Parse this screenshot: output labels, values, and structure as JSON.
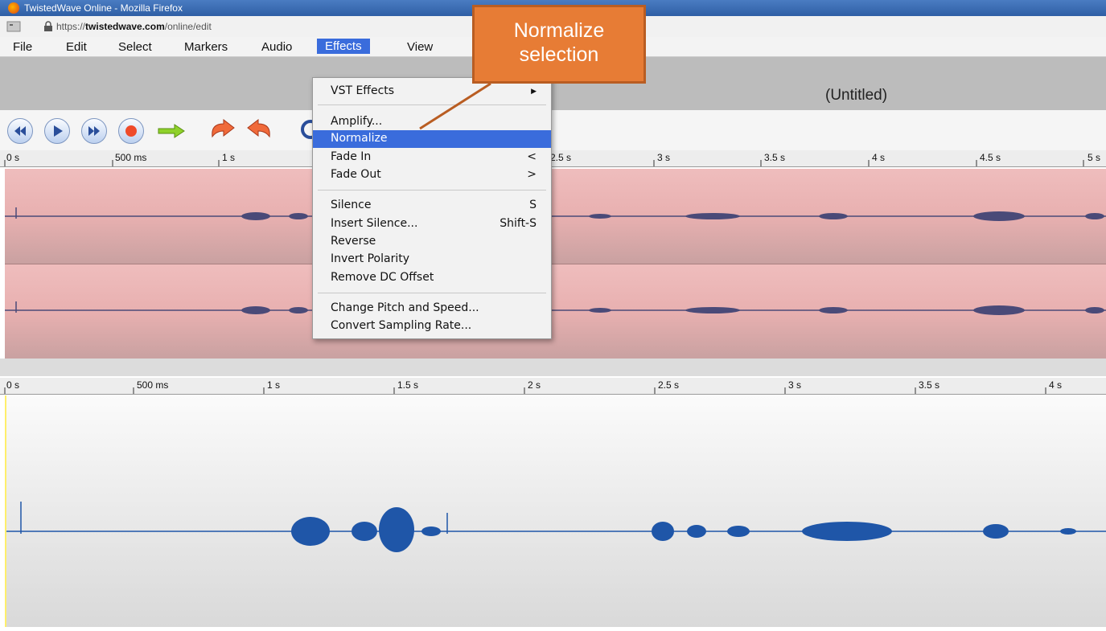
{
  "window": {
    "title": "TwistedWave Online - Mozilla Firefox",
    "url_prefix": "https://",
    "url_domain": "twistedwave.com",
    "url_path": "/online/edit"
  },
  "menubar": {
    "items": [
      "File",
      "Edit",
      "Select",
      "Markers",
      "Audio",
      "Effects",
      "View"
    ],
    "active": "Effects"
  },
  "document": {
    "title": "(Untitled)"
  },
  "rulers": {
    "top": [
      "0 s",
      "500 ms",
      "1 s",
      "2.5 s",
      "3 s",
      "3.5 s",
      "4 s",
      "4.5 s",
      "5 s"
    ],
    "bottom": [
      "0 s",
      "500 ms",
      "1 s",
      "1.5 s",
      "2 s",
      "2.5 s",
      "3 s",
      "3.5 s",
      "4 s"
    ]
  },
  "effects_menu": {
    "items": [
      {
        "label": "VST Effects",
        "shortcut": "",
        "submenu": true
      },
      {
        "label": "Amplify...",
        "shortcut": ""
      },
      {
        "label": "Normalize",
        "shortcut": "",
        "highlighted": true
      },
      {
        "label": "Fade In",
        "shortcut": "<"
      },
      {
        "label": "Fade Out",
        "shortcut": ">"
      },
      {
        "label": "Silence",
        "shortcut": "S"
      },
      {
        "label": "Insert Silence...",
        "shortcut": "Shift-S"
      },
      {
        "label": "Reverse",
        "shortcut": ""
      },
      {
        "label": "Invert Polarity",
        "shortcut": ""
      },
      {
        "label": "Remove DC Offset",
        "shortcut": ""
      },
      {
        "label": "Change Pitch and Speed...",
        "shortcut": ""
      },
      {
        "label": "Convert Sampling Rate...",
        "shortcut": ""
      }
    ]
  },
  "callout": {
    "line1": "Normalize",
    "line2": "selection"
  },
  "colors": {
    "highlight": "#3a6cdc",
    "track": "#e8b0b0",
    "waveform_top": "#4a4a78",
    "waveform_bottom": "#1f56a8",
    "callout": "#e77c35"
  }
}
